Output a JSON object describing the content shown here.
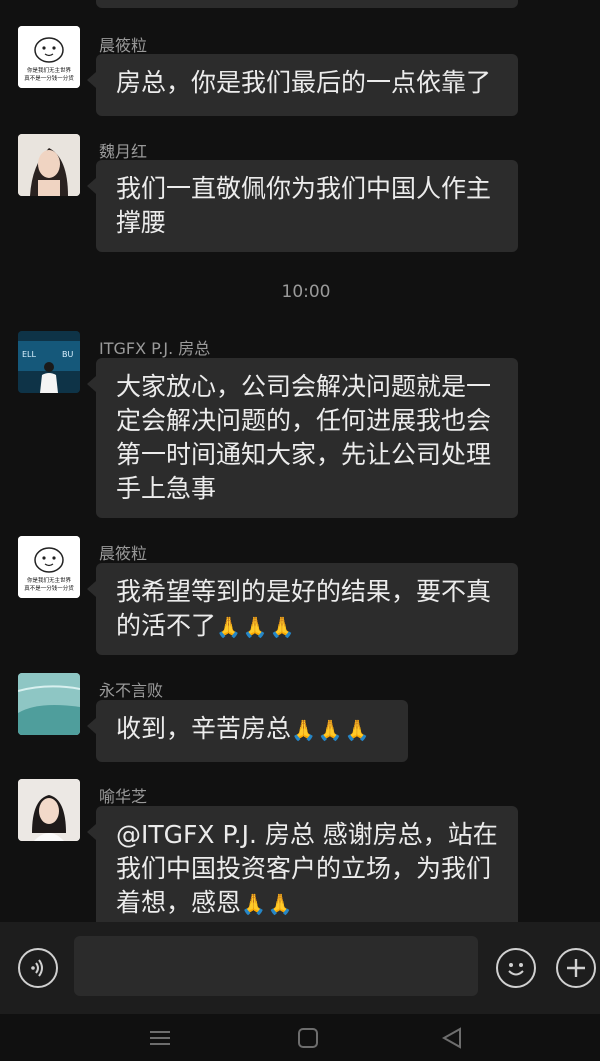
{
  "messages": [
    {
      "sender": "晨筱粒",
      "text": "房总，你是我们最后的一点依靠了",
      "avatar": "meme-avatar-icon"
    },
    {
      "sender": "魏月红",
      "text": "我们一直敬佩你为我们中国人作主撑腰",
      "avatar": "woman-photo-avatar"
    },
    {
      "sender": "ITGFX P.J. 房总",
      "text": "大家放心，公司会解决问题就是一定会解决问题的，任何进展我也会第一时间通知大家，先让公司处理手上急事",
      "avatar": "trader-photo-avatar"
    },
    {
      "sender": "晨筱粒",
      "text": "我希望等到的是好的结果，要不真的活不了",
      "emoji": "🙏🙏🙏",
      "avatar": "meme-avatar-icon"
    },
    {
      "sender": "永不言败",
      "text": "收到，辛苦房总",
      "emoji": "🙏🙏🙏",
      "avatar": "sea-photo-avatar"
    },
    {
      "sender": "喻华芝",
      "text": "@ITGFX P.J. 房总  感谢房总，站在我们中国投资客户的立场，为我们着想，感恩",
      "emoji": "🙏🙏",
      "avatar": "woman2-photo-avatar"
    }
  ],
  "timestamp": "10:00",
  "meme_caption_line1": "你是我们无主世界",
  "meme_caption_line2": "真不是一分钱一分货",
  "trader_screen_text_left": "ELL",
  "trader_screen_text_right": "BU",
  "input": {
    "value": "",
    "voice_icon": "voice-icon",
    "emoji_icon": "emoji-icon",
    "plus_icon": "plus-icon"
  },
  "navbar": {
    "menu_icon": "menu-icon",
    "home_icon": "home-icon",
    "back_icon": "back-icon"
  },
  "colors": {
    "background": "#111111",
    "bubble": "#2c2c2c",
    "name_text": "#9a9a9a",
    "input_bar": "#1d1d1d"
  }
}
